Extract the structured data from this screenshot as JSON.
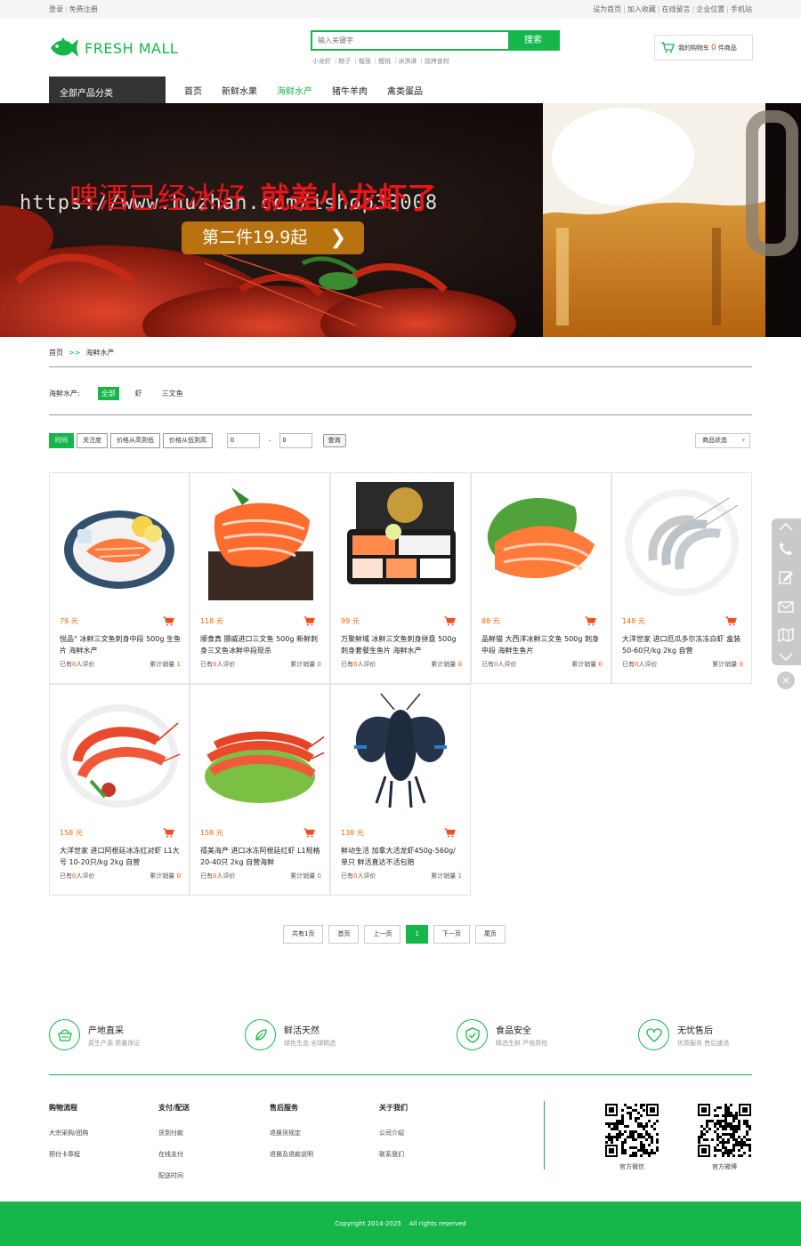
{
  "topbar": {
    "login": "登录",
    "register": "免费注册",
    "links": [
      "设为首页",
      "加入收藏",
      "在线留言",
      "企业位置",
      "手机站"
    ]
  },
  "logo": {
    "text": "FRESH MALL"
  },
  "search": {
    "placeholder": "输入关键字",
    "button": "搜索",
    "hot": [
      "小龙虾",
      "粽子",
      "榴莲",
      "樱桃",
      "冰淇淋",
      "烧烤食材"
    ]
  },
  "cart": {
    "prefix": "我的购物车",
    "count": "0",
    "suffix": "件商品"
  },
  "nav": {
    "all_categories": "全部产品分类",
    "links": [
      "首页",
      "新鲜水果",
      "海鲜水产",
      "猪牛羊肉",
      "禽类蛋品"
    ],
    "active": "海鲜水产"
  },
  "banner": {
    "watermark": "https://www.huzhan.com/ishop33008",
    "headline_a": "啤酒已经冰好",
    "headline_b": "就差小龙虾了",
    "cta": "第二件19.9起"
  },
  "breadcrumb": {
    "home": "首页",
    "arrow": ">>",
    "current": "海鲜水产"
  },
  "filter": {
    "label": "海鲜水产:",
    "options": [
      "全部",
      "虾",
      "三文鱼"
    ],
    "selected": "全部"
  },
  "sort": {
    "buttons": [
      "时间",
      "关注度",
      "价格从高到低",
      "价格从低到高"
    ],
    "active": "时间",
    "min": "0",
    "max": "0",
    "dash": "-",
    "query": "查询",
    "state": "商品状态"
  },
  "products": [
    {
      "price": "79 元",
      "name": "悦品° 冰鲜三文鱼刺身中段 500g 生鱼片 海鲜水产",
      "reviews_pre": "已有",
      "reviews": "0",
      "reviews_post": "人评价",
      "sales_pre": "累计销量",
      "sales": "1",
      "img": "salmon-plate"
    },
    {
      "price": "118 元",
      "name": "顺食真 挪威进口三文鱼 500g 新鲜刺身三文鱼冰鲜中段现杀",
      "reviews_pre": "已有",
      "reviews": "0",
      "reviews_post": "人评价",
      "sales_pre": "累计销量",
      "sales": "0",
      "img": "salmon-board"
    },
    {
      "price": "99 元",
      "name": "万聚鲜域 冰鲜三文鱼刺身拼盘 500g 刺身套餐生鱼片 海鲜水产",
      "reviews_pre": "已有",
      "reviews": "0",
      "reviews_post": "人评价",
      "sales_pre": "累计销量",
      "sales": "0",
      "img": "sashimi-box"
    },
    {
      "price": "88 元",
      "name": "品鲜猫 大西洋冰鲜三文鱼 500g 刺身中段 海鲜生鱼片",
      "reviews_pre": "已有",
      "reviews": "0",
      "reviews_post": "人评价",
      "sales_pre": "累计销量",
      "sales": "0",
      "img": "salmon-leaf"
    },
    {
      "price": "148 元",
      "name": "大洋世家 进口厄瓜多尔冻冻白虾 盒装 50-60只/kg 2kg 自营",
      "reviews_pre": "已有",
      "reviews": "0",
      "reviews_post": "人评价",
      "sales_pre": "累计销量",
      "sales": "0",
      "img": "white-shrimp"
    },
    {
      "price": "158 元",
      "name": "大洋世家 进口阿根廷冰冻红对虾 L1大号 10-20只/kg 2kg 自营",
      "reviews_pre": "已有",
      "reviews": "0",
      "reviews_post": "人评价",
      "sales_pre": "累计销量",
      "sales": "0",
      "img": "red-shrimp-plate"
    },
    {
      "price": "158 元",
      "name": "禧美海产 进口冰冻阿根廷红虾 L1规格 20-40只 2kg 自营海鲜",
      "reviews_pre": "已有",
      "reviews": "0",
      "reviews_post": "人评价",
      "sales_pre": "累计销量",
      "sales": "0",
      "img": "red-shrimp-lettuce"
    },
    {
      "price": "138 元",
      "name": "鲜动生活 加拿大活龙虾450g-560g/单只 鲜活直达不活包赔",
      "reviews_pre": "已有",
      "reviews": "0",
      "reviews_post": "人评价",
      "sales_pre": "累计销量",
      "sales": "1",
      "img": "lobster"
    }
  ],
  "pager": {
    "total": "共有1页",
    "first": "首页",
    "prev": "上一页",
    "current": "1",
    "next": "下一页",
    "last": "尾页"
  },
  "features": [
    {
      "title": "产地直采",
      "sub": "原生产源 质量保证",
      "icon": "basket-icon"
    },
    {
      "title": "鲜活天然",
      "sub": "绿色生态 全球精选",
      "icon": "leaf-icon"
    },
    {
      "title": "食品安全",
      "sub": "精选生鲜 严格质检",
      "icon": "shield-check-icon"
    },
    {
      "title": "无忧售后",
      "sub": "优质服务 售后速退",
      "icon": "heart-icon"
    }
  ],
  "footer_cols": [
    {
      "title": "购物流程",
      "items": [
        "大宗采购/团购",
        "预付卡章程"
      ]
    },
    {
      "title": "支付/配送",
      "items": [
        "货到付款",
        "在线支付",
        "配送时间"
      ]
    },
    {
      "title": "售后服务",
      "items": [
        "退换货规定",
        "退换及退款说明"
      ]
    },
    {
      "title": "关于我们",
      "items": [
        "公司介绍",
        "联系我们"
      ]
    }
  ],
  "qrcodes": [
    "官方微信",
    "官方微博"
  ],
  "copyright": "Copyright 2014-2025    All rights reserved",
  "colors": {
    "brand": "#16b64a",
    "price": "#ff6600",
    "banner_red": "#e8151b",
    "cta": "#b8720f"
  }
}
